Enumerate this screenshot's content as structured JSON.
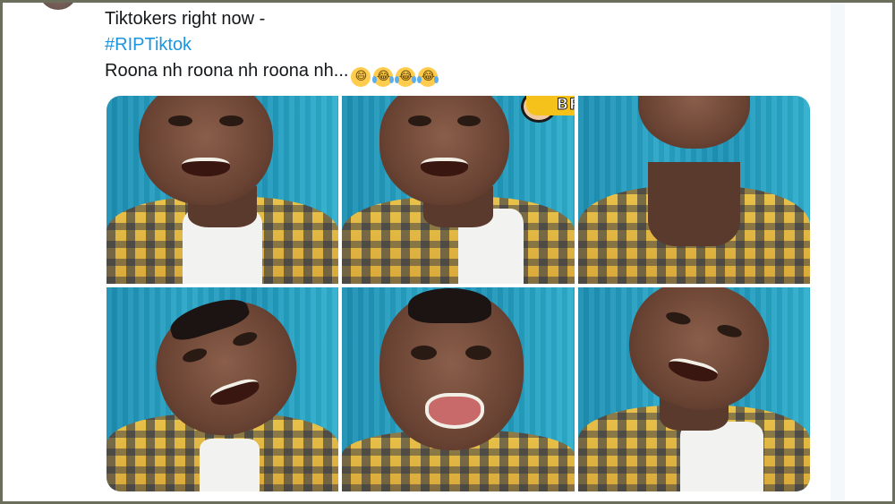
{
  "tweet": {
    "line1": "Tiktokers right now -",
    "hashtag": "#RIPTiktok",
    "line3": "Roona nh roona nh roona nh...",
    "emojis": [
      "😄",
      "😂",
      "😂",
      "😂"
    ]
  },
  "media": {
    "sticker_text": "BRO",
    "tiles": [
      {
        "name": "photo-1"
      },
      {
        "name": "photo-2"
      },
      {
        "name": "photo-3"
      },
      {
        "name": "photo-4"
      },
      {
        "name": "photo-5"
      },
      {
        "name": "photo-6"
      }
    ]
  },
  "colors": {
    "hashtag": "#1b95e0",
    "text": "#14171a",
    "background": "#f5f8fa",
    "frame": "#6b6e5a"
  }
}
